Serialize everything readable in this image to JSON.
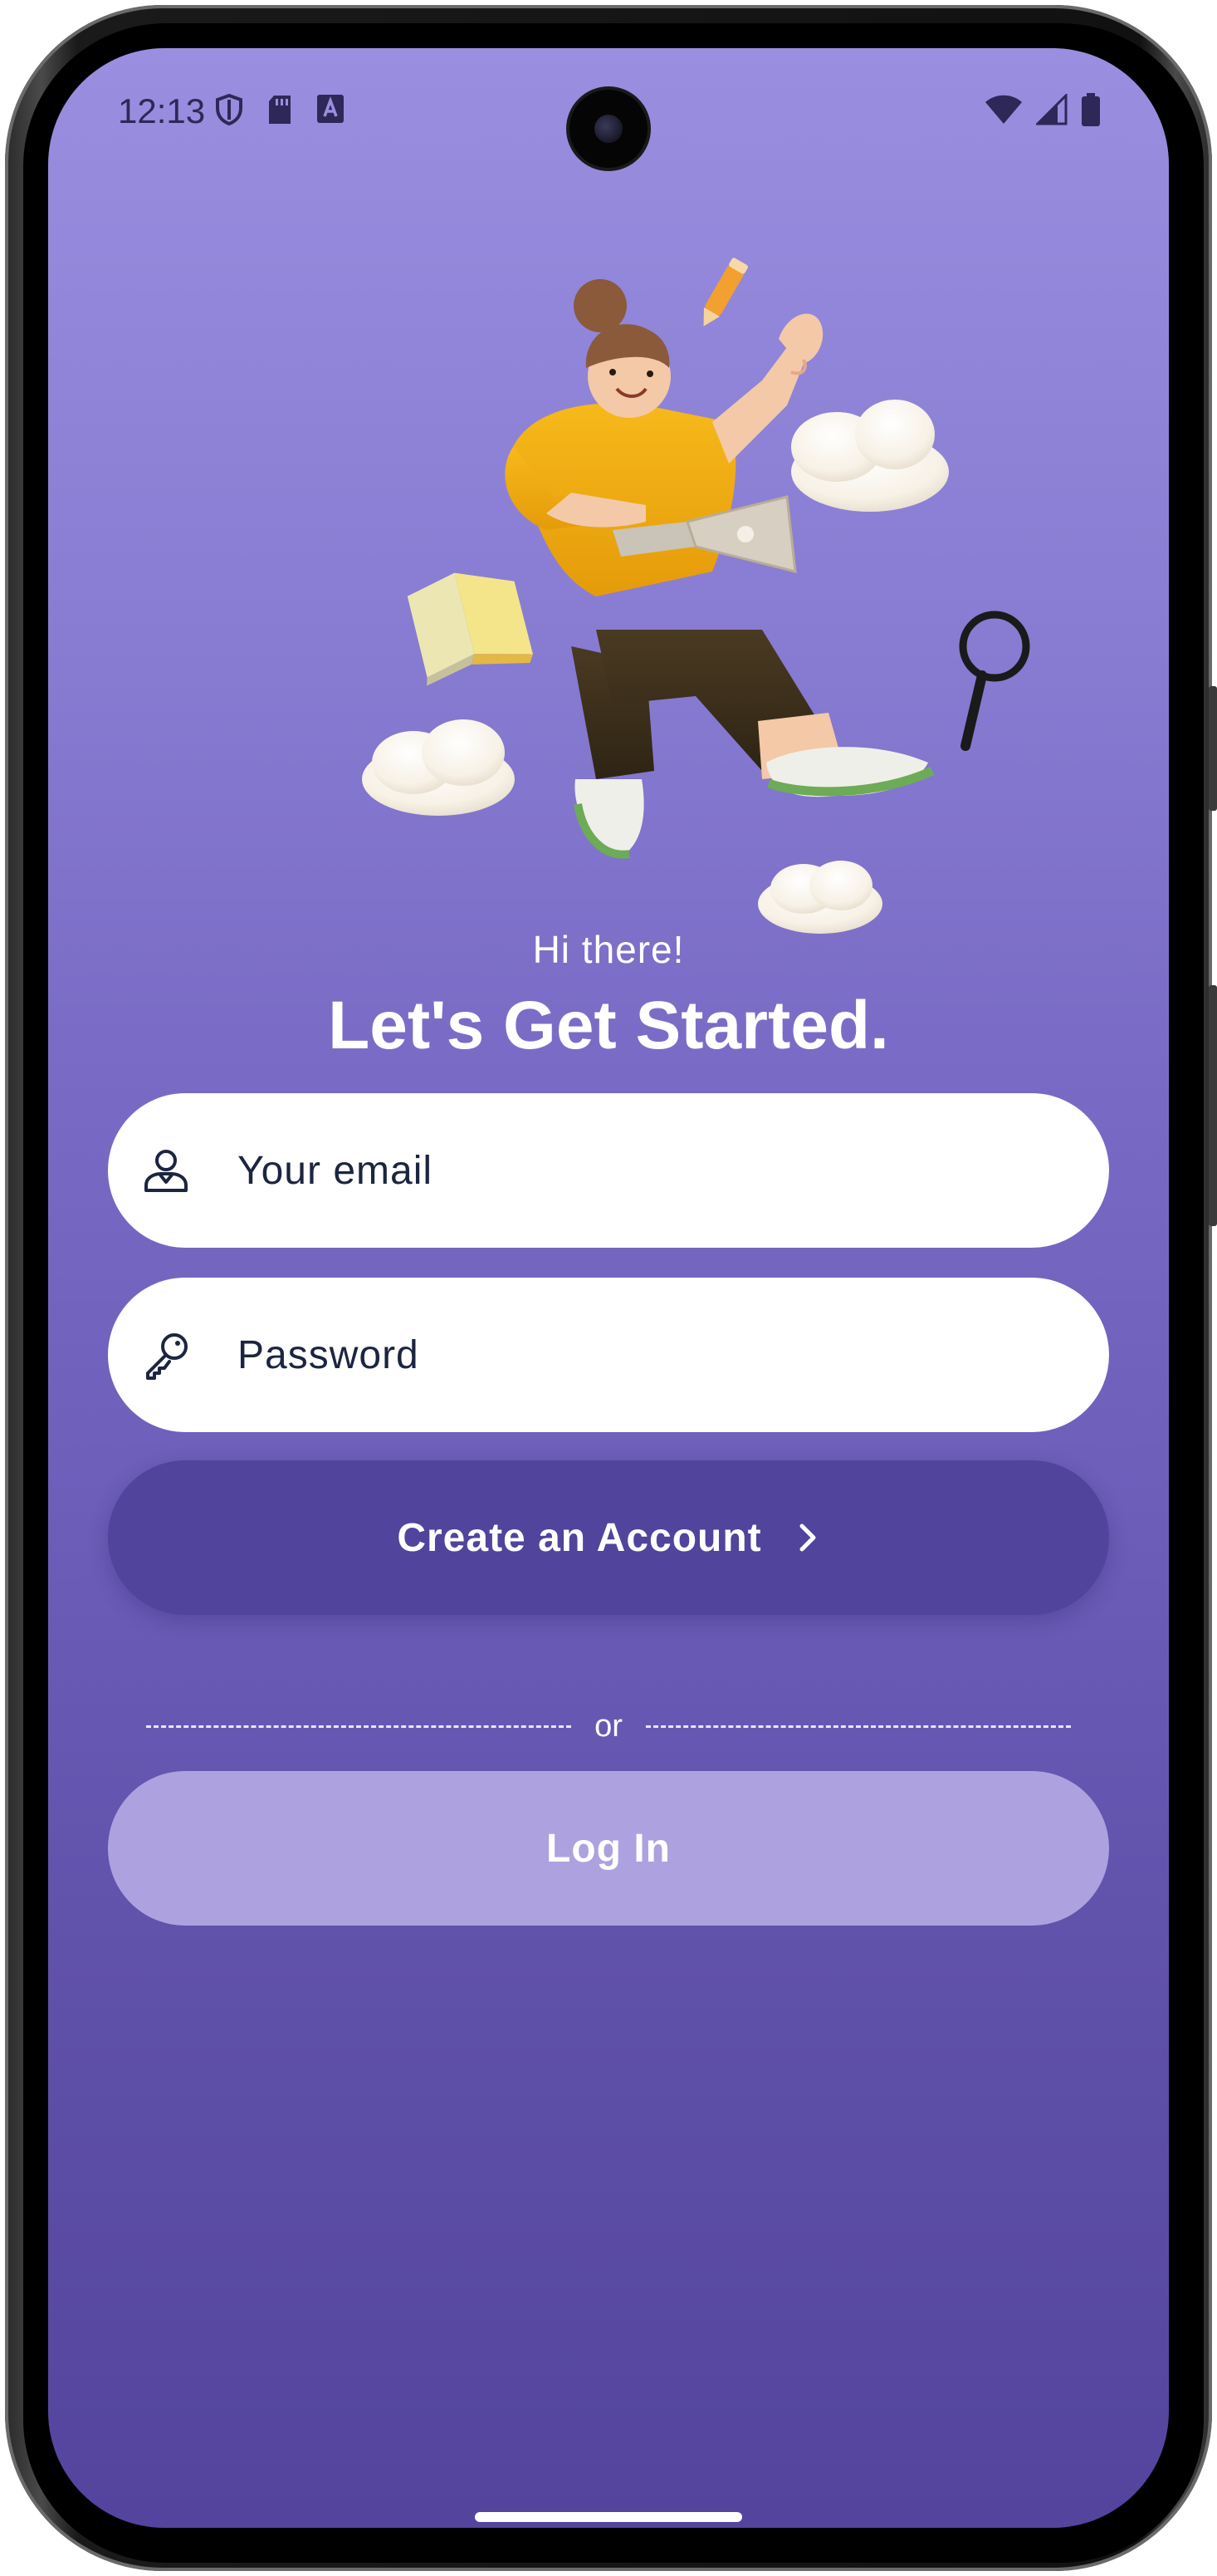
{
  "status_bar": {
    "time": "12:13",
    "left_icons": [
      "shield-icon",
      "sd-card-icon",
      "keyboard-a-icon"
    ],
    "right_icons": [
      "wifi-icon",
      "cellular-signal-icon",
      "battery-icon"
    ]
  },
  "hero": {
    "illustration": "person-floating-with-laptop-illustration"
  },
  "greeting": "Hi there!",
  "headline": "Let's Get Started.",
  "email_field": {
    "placeholder": "Your email",
    "value": "",
    "icon": "user-icon"
  },
  "password_field": {
    "placeholder": "Password",
    "value": "",
    "icon": "key-icon"
  },
  "create_account_button": {
    "label": "Create an Account",
    "icon": "chevron-right-icon"
  },
  "divider": {
    "label": "or"
  },
  "login_button": {
    "label": "Log In"
  },
  "colors": {
    "gradient_top": "#9a8ee0",
    "gradient_bottom": "#54449e",
    "primary_button": "#50449c",
    "secondary_button": "#ada2df",
    "input_bg": "#ffffff",
    "input_text": "#1c2540"
  }
}
